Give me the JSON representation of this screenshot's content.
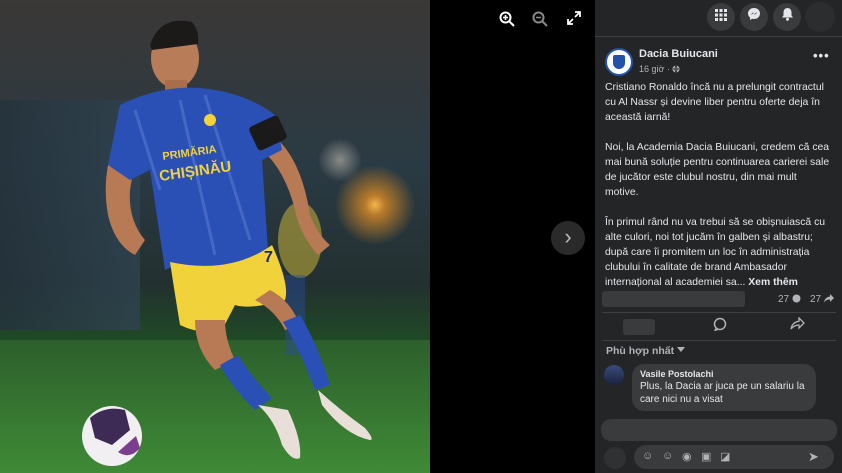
{
  "viewer": {
    "zoom_in_icon": "zoom-in-icon",
    "zoom_out_icon": "zoom-out-icon",
    "fullscreen_icon": "fullscreen-icon",
    "next_icon": "chevron-right-icon"
  },
  "topbar": {
    "menu_icon": "grid-menu-icon",
    "messenger_icon": "messenger-icon",
    "notifications_icon": "bell-icon"
  },
  "post": {
    "page_name": "Dacia Buiucani",
    "time": "16 giờ",
    "paragraphs": [
      "Cristiano Ronaldo încă nu a prelungit contractul cu Al Nassr și devine liber pentru oferte deja în această iarnă!",
      "Noi, la Academia Dacia Buiucani, credem că cea mai bună soluție pentru continuarea carierei sale de jucător este clubul nostru, din mai mult motive.",
      "În primul rând nu va trebui să se obișnuiască cu alte culori, noi tot jucăm în galben și albastru; după care îi promitem un loc în administrația clubului în calitate de brand Ambasador internațional al academiei sa..."
    ],
    "see_more": "Xem thêm",
    "comments_count": "27",
    "shares_count": "27"
  },
  "comments": {
    "sort_label": "Phù hợp nhất",
    "items": [
      {
        "author": "Vasile Postolachi",
        "text": "Plus, la Dacia ar juca pe un salariu la care nici nu a visat"
      }
    ]
  },
  "colors": {
    "panel_bg": "#242526",
    "bubble_bg": "#3a3b3c",
    "jersey_blue": "#2a4fb5",
    "shorts_yellow": "#f2d23a"
  }
}
